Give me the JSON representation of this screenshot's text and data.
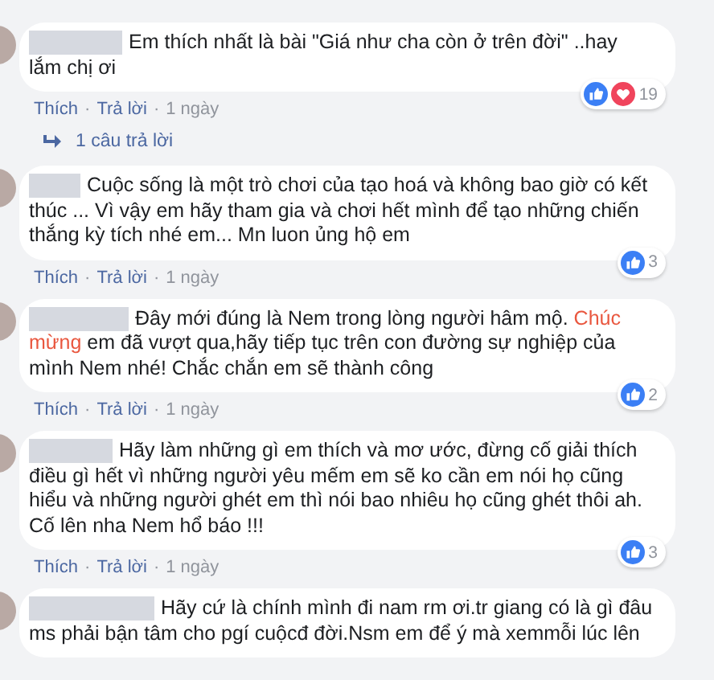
{
  "comments": [
    {
      "text_parts": [
        {
          "kind": "plain",
          "text": "Em thích nhất là bài \"Giá như cha còn ở trên đời\" ..hay lắm chị ơi"
        }
      ],
      "reactions": [
        {
          "kind": "like"
        },
        {
          "kind": "love"
        }
      ],
      "reaction_count": "19",
      "actions": [
        {
          "kind": "link",
          "text": "Thích"
        },
        {
          "kind": "separator",
          "text": "·"
        },
        {
          "kind": "link",
          "text": "Trả lời"
        },
        {
          "kind": "separator",
          "text": "·"
        },
        {
          "kind": "time",
          "text": "1 ngày"
        }
      ],
      "replies": "1 câu trả lời"
    },
    {
      "text_parts": [
        {
          "kind": "plain",
          "text": "Cuộc sống là một trò chơi của tạo hoá và không bao giờ có kết thúc ... Vì vậy em hãy tham gia và chơi hết mình để tạo những chiến thắng kỳ tích nhé em... Mn luon ủng hộ em"
        }
      ],
      "reactions": [
        {
          "kind": "like"
        }
      ],
      "reaction_count": "3",
      "actions": [
        {
          "kind": "link",
          "text": "Thích"
        },
        {
          "kind": "separator",
          "text": "·"
        },
        {
          "kind": "link",
          "text": "Trả lời"
        },
        {
          "kind": "separator",
          "text": "·"
        },
        {
          "kind": "time",
          "text": "1 ngày"
        }
      ]
    },
    {
      "text_parts": [
        {
          "kind": "plain",
          "text": "Đây mới đúng là Nem trong lòng người hâm mộ. "
        },
        {
          "kind": "highlight",
          "text": "Chúc mừng"
        },
        {
          "kind": "plain",
          "text": " em đã vượt qua,hãy tiếp tục trên con đường sự nghiệp của mình Nem nhé! Chắc chắn em sẽ thành công"
        }
      ],
      "reactions": [
        {
          "kind": "like"
        }
      ],
      "reaction_count": "2",
      "actions": [
        {
          "kind": "link",
          "text": "Thích"
        },
        {
          "kind": "separator",
          "text": "·"
        },
        {
          "kind": "link",
          "text": "Trả lời"
        },
        {
          "kind": "separator",
          "text": "·"
        },
        {
          "kind": "time",
          "text": "1 ngày"
        }
      ]
    },
    {
      "text_parts": [
        {
          "kind": "plain",
          "text": "Hãy làm những gì em thích và mơ ước, đừng cố giải thích điều gì hết vì những người yêu mếm em sẽ ko cần em nói họ cũng hiểu và những người ghét em thì nói bao nhiêu họ cũng ghét thôi ah. Cố lên nha Nem hổ báo !!!"
        }
      ],
      "reactions": [
        {
          "kind": "like"
        }
      ],
      "reaction_count": "3",
      "actions": [
        {
          "kind": "link",
          "text": "Thích"
        },
        {
          "kind": "separator",
          "text": "·"
        },
        {
          "kind": "link",
          "text": "Trả lời"
        },
        {
          "kind": "separator",
          "text": "·"
        },
        {
          "kind": "time",
          "text": "1 ngày"
        }
      ]
    },
    {
      "text_parts": [
        {
          "kind": "plain",
          "text": "Hãy cứ là chính mình đi nam rm ơi.tr giang có là gì đâu ms phải bận tâm cho pgí cuộcđ đời.Nsm em để ý mà xemmỗi lúc lên"
        }
      ]
    }
  ]
}
